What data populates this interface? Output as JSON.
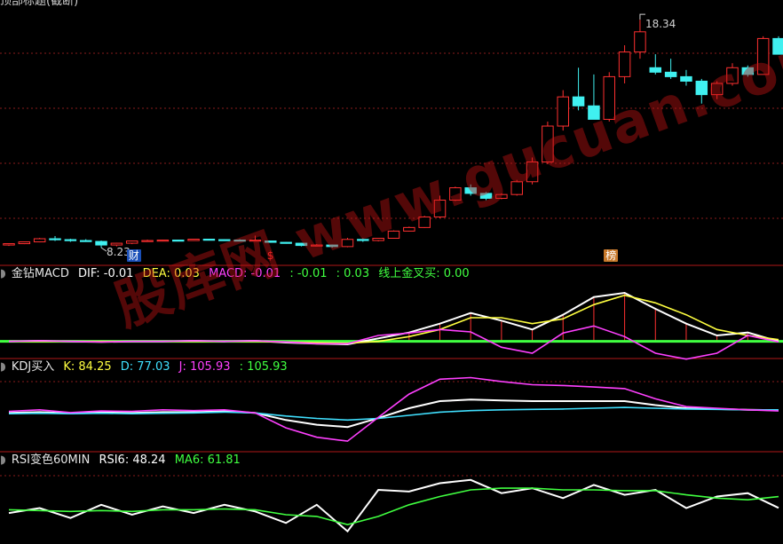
{
  "header_top": {
    "text": "顶部标题(截断)"
  },
  "price_panel": {
    "high_label": "18.34",
    "low_label": "8.23",
    "badges": [
      {
        "text": "财",
        "x_index": 8,
        "color": "#1a4fb8",
        "text_color": "#ffffff"
      },
      {
        "text": "$",
        "x_index": 17,
        "color": "#000000",
        "text_color": "#ff3030"
      },
      {
        "text": "榜",
        "x_index": 39,
        "color": "#c7782a",
        "text_color": "#ffffff"
      }
    ]
  },
  "macd_header": {
    "name": "金钻MACD",
    "dif": "DIF: -0.01",
    "dea": "DEA: 0.03",
    "macd": "MACD: -0.01",
    "v1": ": -0.01",
    "v2": ": 0.03",
    "cross": "线上金叉买: 0.00"
  },
  "kdj_header": {
    "name": "KDJ买入",
    "k": "K: 84.25",
    "d": "D: 77.03",
    "j": "J: 105.93",
    "extra": ": 105.93"
  },
  "rsi_header": {
    "name": "RSI变色60MIN",
    "rsi6": "RSI6: 48.24",
    "ma6": "MA6: 61.81"
  },
  "watermark": "股库网 www.gucuan.com",
  "colors": {
    "up": "#ff3030",
    "down": "#40f0f0",
    "grid": "#8a1c1c",
    "panel_border": "#b01818"
  },
  "chart_data": [
    {
      "type": "candlestick",
      "title": "",
      "candles": [
        [
          8.3,
          8.36,
          8.26,
          8.36
        ],
        [
          8.36,
          8.45,
          8.34,
          8.44
        ],
        [
          8.44,
          8.62,
          8.42,
          8.58
        ],
        [
          8.58,
          8.7,
          8.48,
          8.54
        ],
        [
          8.54,
          8.58,
          8.44,
          8.5
        ],
        [
          8.5,
          8.56,
          8.44,
          8.46
        ],
        [
          8.46,
          8.5,
          8.18,
          8.3
        ],
        [
          8.3,
          8.4,
          8.24,
          8.38
        ],
        [
          8.38,
          8.5,
          8.34,
          8.48
        ],
        [
          8.48,
          8.54,
          8.44,
          8.5
        ],
        [
          8.5,
          8.54,
          8.46,
          8.52
        ],
        [
          8.52,
          8.54,
          8.48,
          8.5
        ],
        [
          8.5,
          8.58,
          8.48,
          8.56
        ],
        [
          8.56,
          8.58,
          8.52,
          8.54
        ],
        [
          8.54,
          8.56,
          8.5,
          8.52
        ],
        [
          8.52,
          8.56,
          8.48,
          8.5
        ],
        [
          8.5,
          8.72,
          8.48,
          8.52
        ],
        [
          8.48,
          8.5,
          8.4,
          8.42
        ],
        [
          8.42,
          8.44,
          8.36,
          8.38
        ],
        [
          8.38,
          8.4,
          8.24,
          8.28
        ],
        [
          8.28,
          8.34,
          8.24,
          8.3
        ],
        [
          8.3,
          8.32,
          8.18,
          8.23
        ],
        [
          8.23,
          8.62,
          8.2,
          8.55
        ],
        [
          8.55,
          8.6,
          8.44,
          8.5
        ],
        [
          8.5,
          8.62,
          8.46,
          8.6
        ],
        [
          8.6,
          8.95,
          8.58,
          8.92
        ],
        [
          8.92,
          9.12,
          8.9,
          9.08
        ],
        [
          9.08,
          9.6,
          9.06,
          9.55
        ],
        [
          9.55,
          10.5,
          9.5,
          10.3
        ],
        [
          10.3,
          10.9,
          10.26,
          10.85
        ],
        [
          10.85,
          11.0,
          10.5,
          10.6
        ],
        [
          10.6,
          10.66,
          10.3,
          10.38
        ],
        [
          10.38,
          10.6,
          10.34,
          10.55
        ],
        [
          10.55,
          11.2,
          10.5,
          11.12
        ],
        [
          11.12,
          12.2,
          11.0,
          12.0
        ],
        [
          12.0,
          13.8,
          11.9,
          13.6
        ],
        [
          13.6,
          15.2,
          13.4,
          14.9
        ],
        [
          14.9,
          16.2,
          14.3,
          14.5
        ],
        [
          14.5,
          15.9,
          13.9,
          13.9
        ],
        [
          13.9,
          16.0,
          13.8,
          15.8
        ],
        [
          15.8,
          17.2,
          15.5,
          16.9
        ],
        [
          16.9,
          18.34,
          16.6,
          17.8
        ],
        [
          16.2,
          16.8,
          15.9,
          16.0
        ],
        [
          16.0,
          16.6,
          15.7,
          15.8
        ],
        [
          15.8,
          16.1,
          15.4,
          15.6
        ],
        [
          15.6,
          15.7,
          14.6,
          15.0
        ],
        [
          15.0,
          15.6,
          14.8,
          15.5
        ],
        [
          15.5,
          16.4,
          15.4,
          16.2
        ],
        [
          16.2,
          16.3,
          15.8,
          15.9
        ],
        [
          15.9,
          17.6,
          15.9,
          17.5
        ],
        [
          17.5,
          17.6,
          16.8,
          16.8
        ]
      ],
      "ylim": [
        7.75,
        18.9
      ]
    },
    {
      "type": "line",
      "title": "金钻MACD",
      "x": [
        0,
        2,
        4,
        6,
        8,
        10,
        12,
        14,
        16,
        18,
        20,
        22,
        24,
        26,
        28,
        30,
        32,
        34,
        36,
        38,
        40,
        42,
        44,
        46,
        48,
        50
      ],
      "series": [
        {
          "name": "DIF",
          "color": "#ffffff",
          "values": [
            0.0,
            0.01,
            0.0,
            -0.01,
            0.0,
            0.0,
            0.01,
            0.0,
            0.01,
            -0.02,
            -0.04,
            -0.05,
            0.05,
            0.15,
            0.3,
            0.48,
            0.35,
            0.2,
            0.45,
            0.75,
            0.82,
            0.55,
            0.3,
            0.1,
            0.15,
            0.0
          ]
        },
        {
          "name": "DEA",
          "color": "#ffff40",
          "values": [
            0.0,
            0.0,
            0.0,
            0.0,
            0.0,
            0.0,
            0.0,
            0.0,
            0.0,
            -0.01,
            -0.02,
            -0.03,
            0.0,
            0.08,
            0.2,
            0.4,
            0.4,
            0.3,
            0.38,
            0.62,
            0.78,
            0.65,
            0.45,
            0.2,
            0.1,
            0.03
          ]
        },
        {
          "name": "MACD",
          "color": "#ff40ff",
          "values": [
            0.0,
            0.01,
            0.0,
            -0.01,
            0.0,
            0.0,
            0.01,
            0.0,
            0.01,
            -0.01,
            -0.04,
            -0.04,
            0.1,
            0.14,
            0.2,
            0.16,
            -0.1,
            -0.2,
            0.14,
            0.26,
            0.08,
            -0.2,
            -0.3,
            -0.2,
            0.1,
            -0.01
          ]
        }
      ],
      "ylim": [
        -0.2,
        1.0
      ]
    },
    {
      "type": "line",
      "title": "KDJ买入",
      "x": [
        0,
        2,
        4,
        6,
        8,
        10,
        12,
        14,
        16,
        18,
        20,
        22,
        24,
        26,
        28,
        30,
        32,
        34,
        36,
        38,
        40,
        42,
        44,
        46,
        48,
        50
      ],
      "series": [
        {
          "name": "K",
          "color": "#ffffff",
          "values": [
            58,
            60,
            57,
            59,
            58,
            60,
            60,
            62,
            58,
            40,
            28,
            22,
            45,
            70,
            88,
            92,
            90,
            88,
            88,
            88,
            88,
            78,
            70,
            68,
            66,
            65
          ]
        },
        {
          "name": "D",
          "color": "#40e0ff",
          "values": [
            56,
            57,
            56,
            57,
            56,
            57,
            58,
            60,
            58,
            50,
            44,
            40,
            44,
            52,
            60,
            64,
            66,
            67,
            68,
            70,
            72,
            70,
            68,
            67,
            66,
            66
          ]
        },
        {
          "name": "J",
          "color": "#ff40ff",
          "values": [
            62,
            66,
            59,
            63,
            62,
            66,
            64,
            66,
            58,
            20,
            -4,
            -14,
            47,
            106,
            144,
            148,
            138,
            130,
            128,
            124,
            120,
            94,
            74,
            70,
            66,
            63
          ]
        }
      ],
      "ylim": [
        -25,
        165
      ]
    },
    {
      "type": "line",
      "title": "RSI变色60MIN",
      "x": [
        0,
        2,
        4,
        6,
        8,
        10,
        12,
        14,
        16,
        18,
        20,
        22,
        24,
        26,
        28,
        30,
        32,
        34,
        36,
        38,
        40,
        42,
        44,
        46,
        48,
        50
      ],
      "series": [
        {
          "name": "RSI6",
          "color": "#ffffff",
          "values": [
            42,
            48,
            36,
            52,
            40,
            50,
            42,
            52,
            44,
            30,
            52,
            20,
            70,
            68,
            78,
            82,
            66,
            72,
            60,
            76,
            64,
            70,
            48,
            62,
            66,
            48.24
          ]
        },
        {
          "name": "MA6",
          "color": "#40ff40",
          "values": [
            46,
            45,
            44,
            45,
            44,
            46,
            46,
            47,
            46,
            40,
            38,
            28,
            38,
            52,
            62,
            70,
            72,
            72,
            70,
            70,
            69,
            69,
            64,
            60,
            58,
            61.81
          ]
        }
      ],
      "ylim": [
        10,
        100
      ]
    }
  ]
}
